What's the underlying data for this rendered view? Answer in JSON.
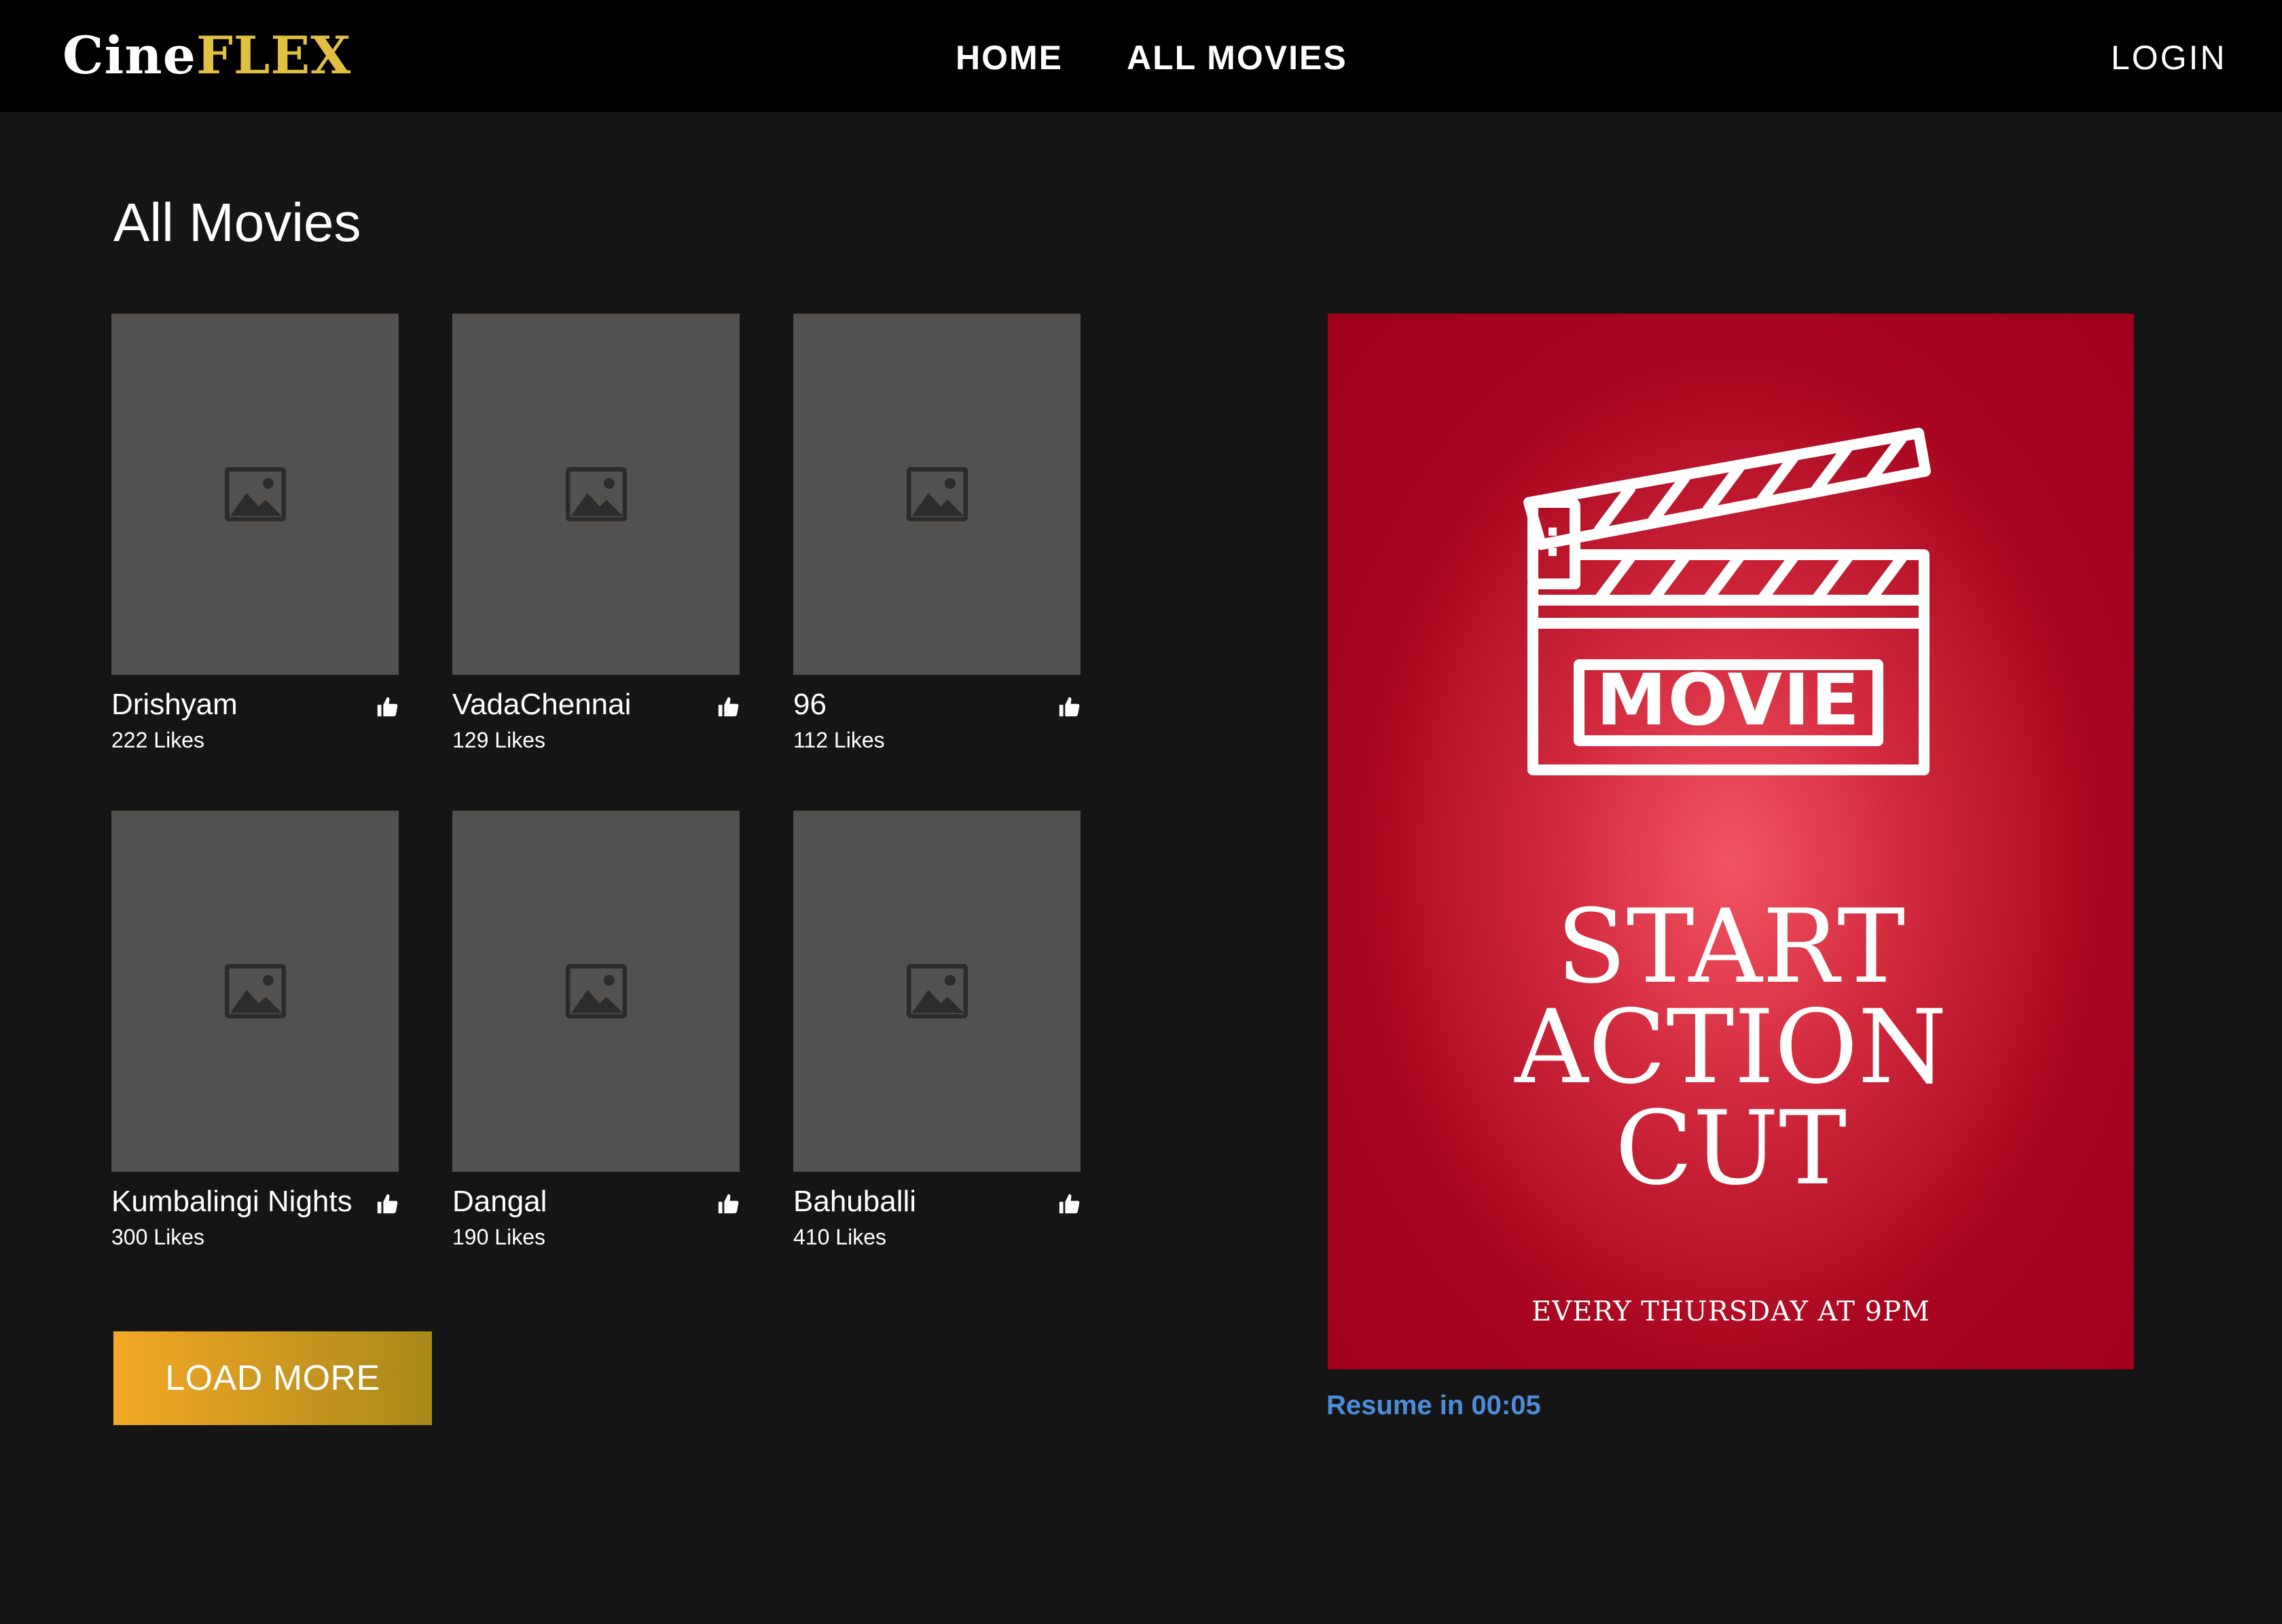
{
  "brand": {
    "part1": "Cine",
    "part2": "FLEX",
    "accent_color": "#e2c042"
  },
  "nav": {
    "home": "HOME",
    "all_movies": "ALL MOVIES",
    "login": "LOGIN"
  },
  "page_title": "All Movies",
  "movies": [
    {
      "title": "Drishyam",
      "likes": "222 Likes"
    },
    {
      "title": "VadaChennai",
      "likes": "129 Likes"
    },
    {
      "title": "96",
      "likes": "112 Likes"
    },
    {
      "title": "Kumbalingi Nights",
      "likes": "300 Likes"
    },
    {
      "title": "Dangal",
      "likes": "190 Likes"
    },
    {
      "title": "Bahuballi",
      "likes": "410 Likes"
    }
  ],
  "icons": {
    "poster_placeholder": "image-placeholder-icon",
    "like": "thumbs-up-icon",
    "ad": "clapperboard-icon"
  },
  "load_more_label": "LOAD MORE",
  "ad": {
    "badge": "MOVIE",
    "line1": "START",
    "line2": "ACTION",
    "line3": "CUT",
    "subline": "EVERY THURSDAY AT 9PM",
    "background_color": "#a8061f"
  },
  "resume_text": "Resume in 00:05",
  "colors": {
    "background": "#151515",
    "topbar": "#000000",
    "poster": "#525150",
    "resume": "#4c8ddb",
    "button_start": "#f4a826",
    "button_end": "#a8891a"
  }
}
